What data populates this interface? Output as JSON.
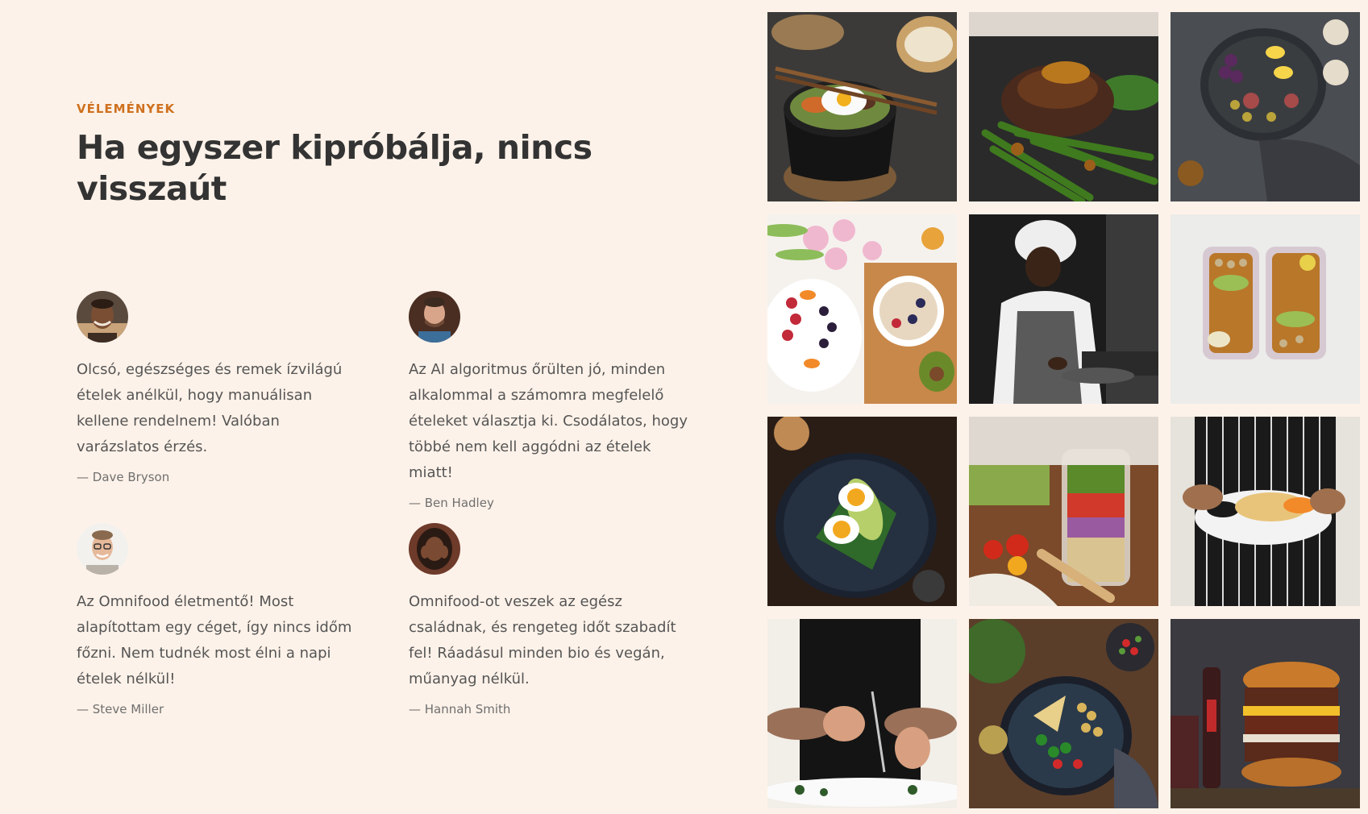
{
  "section": {
    "subheading": "VÉLEMÉNYEK",
    "heading": "Ha egyszer kipróbálja, nincs visszaút"
  },
  "testimonials": [
    {
      "quote": "Olcsó, egészséges és remek ízvilágú ételek anélkül, hogy manuálisan kellene rendelnem! Valóban varázslatos érzés.",
      "name": "— Dave Bryson"
    },
    {
      "quote": "Az AI algoritmus őrülten jó, minden alkalommal a számomra megfelelő ételeket választja ki. Csodálatos, hogy többé nem kell aggódni az ételek miatt!",
      "name": "— Ben Hadley"
    },
    {
      "quote": "Az Omnifood életmentő! Most alapítottam egy céget, így nincs időm főzni. Nem tudnék most élni a napi ételek nélkül!",
      "name": "— Steve Miller"
    },
    {
      "quote": "Omnifood-ot veszek az egész családnak, és rengeteg időt szabadít fel! Ráadásul minden bio és vegán, műanyag nélkül.",
      "name": "— Hannah Smith"
    }
  ],
  "colors": {
    "background": "#fdf2e9",
    "accent": "#cf711f",
    "heading": "#333333"
  },
  "gallery": [
    "bibimbap-bowl-photo",
    "steak-green-beans-photo",
    "fruit-platter-photo",
    "fruit-bowl-photo",
    "chef-cooking-photo",
    "meal-prep-boxes-photo",
    "egg-avocado-toast-photo",
    "salad-jar-photo",
    "waiter-plate-photo",
    "chef-plating-photo",
    "chickpea-salad-bowl-photo",
    "burger-stack-photo"
  ]
}
